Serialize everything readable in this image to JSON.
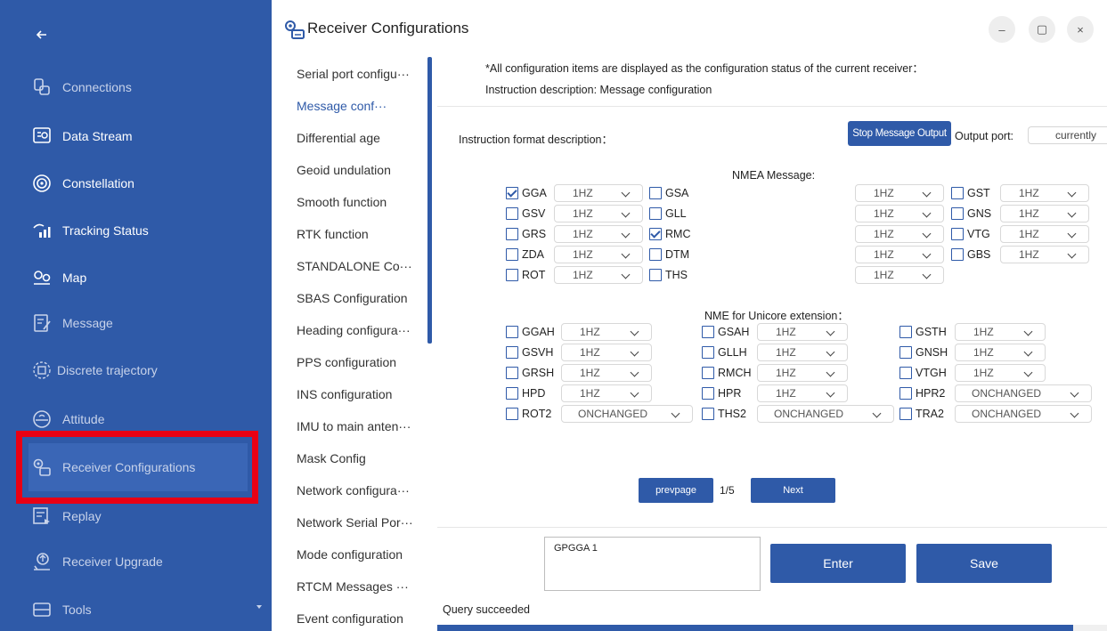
{
  "sidebar": {
    "items": [
      {
        "label": "Connections",
        "icon": "connections-icon"
      },
      {
        "label": "Data Stream",
        "icon": "data-stream-icon"
      },
      {
        "label": "Constellation",
        "icon": "constellation-icon"
      },
      {
        "label": "Tracking Status",
        "icon": "tracking-status-icon"
      },
      {
        "label": "Map",
        "icon": "map-icon"
      },
      {
        "label": "Message",
        "icon": "message-icon"
      },
      {
        "label": "Discrete trajectory",
        "icon": "discrete-trajectory-icon"
      },
      {
        "label": "Attitude",
        "icon": "attitude-icon"
      },
      {
        "label": "Receiver Configurations",
        "icon": "receiver-config-icon"
      },
      {
        "label": "Replay",
        "icon": "replay-icon"
      },
      {
        "label": "Receiver Upgrade",
        "icon": "receiver-upgrade-icon"
      },
      {
        "label": "Tools",
        "icon": "tools-icon"
      }
    ]
  },
  "window": {
    "title": "Receiver Configurations",
    "minimize": "–",
    "maximize": "▢",
    "close": "×"
  },
  "subnav": {
    "items": [
      {
        "label": "Serial port configu···"
      },
      {
        "label": "Message conf···"
      },
      {
        "label": "Differential age"
      },
      {
        "label": "Geoid undulation"
      },
      {
        "label": "Smooth function"
      },
      {
        "label": "RTK function"
      },
      {
        "label": "STANDALONE Co···"
      },
      {
        "label": "SBAS Configuration"
      },
      {
        "label": "Heading configura···"
      },
      {
        "label": "PPS configuration"
      },
      {
        "label": "INS configuration"
      },
      {
        "label": "IMU to main anten···"
      },
      {
        "label": "Mask Config"
      },
      {
        "label": "Network configura···"
      },
      {
        "label": "Network Serial Por···"
      },
      {
        "label": "Mode configuration"
      },
      {
        "label": "RTCM Messages ···"
      },
      {
        "label": "Event configuration"
      }
    ]
  },
  "content": {
    "note": "*All configuration items are displayed as the configuration status of the current receiver：",
    "instruction": "Instruction description:  Message configuration",
    "format_desc": "Instruction format description：",
    "stop_button": "Stop Message Output",
    "output_port_label": "Output port:",
    "output_port_value": "currently",
    "nmea_title": "NMEA Message:",
    "nmea": [
      {
        "label": "GGA",
        "checked": true,
        "rate": "1HZ"
      },
      {
        "label": "GSA",
        "checked": false,
        "rate": "1HZ"
      },
      {
        "label": "GST",
        "checked": false,
        "rate": "1HZ"
      },
      {
        "label": "GSV",
        "checked": false,
        "rate": "1HZ"
      },
      {
        "label": "GLL",
        "checked": false,
        "rate": "1HZ"
      },
      {
        "label": "GNS",
        "checked": false,
        "rate": "1HZ"
      },
      {
        "label": "GRS",
        "checked": false,
        "rate": "1HZ"
      },
      {
        "label": "RMC",
        "checked": true,
        "rate": "1HZ"
      },
      {
        "label": "VTG",
        "checked": false,
        "rate": "1HZ"
      },
      {
        "label": "ZDA",
        "checked": false,
        "rate": "1HZ"
      },
      {
        "label": "DTM",
        "checked": false,
        "rate": "1HZ"
      },
      {
        "label": "GBS",
        "checked": false,
        "rate": "1HZ"
      },
      {
        "label": "ROT",
        "checked": false,
        "rate": "1HZ"
      },
      {
        "label": "THS",
        "checked": false,
        "rate": "1HZ"
      }
    ],
    "unicore_title": "NME for Unicore extension：",
    "unicore": [
      {
        "label": "GGAH",
        "checked": false,
        "rate": "1HZ"
      },
      {
        "label": "GSAH",
        "checked": false,
        "rate": "1HZ"
      },
      {
        "label": "GSTH",
        "checked": false,
        "rate": "1HZ"
      },
      {
        "label": "GSVH",
        "checked": false,
        "rate": "1HZ"
      },
      {
        "label": "GLLH",
        "checked": false,
        "rate": "1HZ"
      },
      {
        "label": "GNSH",
        "checked": false,
        "rate": "1HZ"
      },
      {
        "label": "GRSH",
        "checked": false,
        "rate": "1HZ"
      },
      {
        "label": "RMCH",
        "checked": false,
        "rate": "1HZ"
      },
      {
        "label": "VTGH",
        "checked": false,
        "rate": "1HZ"
      },
      {
        "label": "HPD",
        "checked": false,
        "rate": "1HZ"
      },
      {
        "label": "HPR",
        "checked": false,
        "rate": "1HZ"
      },
      {
        "label": "HPR2",
        "checked": false,
        "rate": "ONCHANGED"
      },
      {
        "label": "ROT2",
        "checked": false,
        "rate": "ONCHANGED"
      },
      {
        "label": "THS2",
        "checked": false,
        "rate": "ONCHANGED"
      },
      {
        "label": "TRA2",
        "checked": false,
        "rate": "ONCHANGED"
      }
    ],
    "prev_button": "prevpage",
    "page_indicator": "1/5",
    "next_button": "Next",
    "command_text": "GPGGA 1",
    "enter_button": "Enter",
    "save_button": "Save",
    "status": "Query succeeded",
    "progress": 0.95
  },
  "colors": {
    "sidebar_bg": "#2f5aa8",
    "accent": "#2f5aa8",
    "highlight_border": "#e90014"
  }
}
